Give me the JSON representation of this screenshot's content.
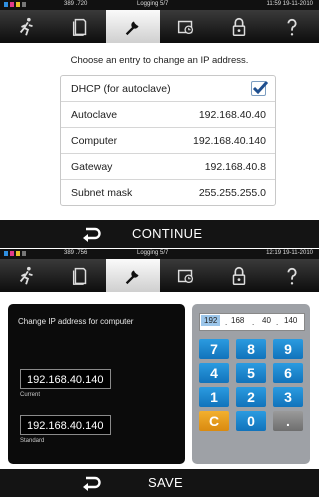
{
  "screen1": {
    "status": {
      "left_code": "389 .720",
      "center": "Logging 5/7",
      "right": "11:59  19-11-2010"
    },
    "tabs": [
      {
        "icon": "running-person-icon",
        "active": false
      },
      {
        "icon": "document-icon",
        "active": false
      },
      {
        "icon": "wrench-icon",
        "active": true
      },
      {
        "icon": "camera-timer-icon",
        "active": false
      },
      {
        "icon": "padlock-icon",
        "active": false
      },
      {
        "icon": "help-icon",
        "active": false
      }
    ],
    "instruction": "Choose an entry to change an IP address.",
    "rows": [
      {
        "label": "DHCP (for autoclave)",
        "checked": true
      },
      {
        "label": "Autoclave",
        "value": "192.168.40.40"
      },
      {
        "label": "Computer",
        "value": "192.168.40.140"
      },
      {
        "label": "Gateway",
        "value": "192.168.40.8"
      },
      {
        "label": "Subnet mask",
        "value": "255.255.255.0"
      }
    ],
    "bottom": {
      "action_label": "CONTINUE"
    }
  },
  "screen2": {
    "status": {
      "left_code": "389 .756",
      "center": "Logging 5/7",
      "right": "12:19  19-11-2010"
    },
    "panel_title": "Change IP address for computer",
    "current_value": "192.168.40.140",
    "current_label": "Current",
    "standard_value": "192.168.40.140",
    "standard_label": "Standard",
    "octets": [
      "192",
      "168",
      "40",
      "140"
    ],
    "keys": [
      "7",
      "8",
      "9",
      "4",
      "5",
      "6",
      "1",
      "2",
      "3",
      "C",
      "0",
      "."
    ],
    "bottom": {
      "action_label": "SAVE"
    }
  },
  "colors": {
    "key_blue": "#1a86d0",
    "key_orange": "#e89a1c",
    "checkbox_blue": "#1f4f8f"
  }
}
